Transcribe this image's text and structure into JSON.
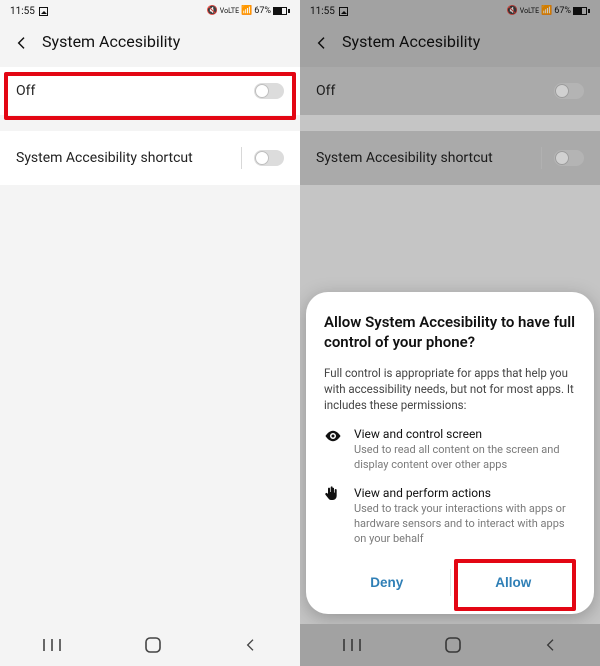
{
  "status": {
    "time": "11:55",
    "net_label": "VoLTE",
    "battery": "67%"
  },
  "header": {
    "title": "System Accesibility"
  },
  "rows": {
    "main_state": "Off",
    "shortcut_label": "System Accesibility shortcut"
  },
  "dialog": {
    "title": "Allow System Accesibility to have full control of your phone?",
    "description": "Full control is appropriate for apps that help you with accessibility needs, but not for most apps. It includes these permissions:",
    "perm1_title": "View and control screen",
    "perm1_sub": "Used to read all content on the screen and display content over other apps",
    "perm2_title": "View and perform actions",
    "perm2_sub": "Used to track your interactions with apps or hardware sensors and to interact with apps on your behalf",
    "deny": "Deny",
    "allow": "Allow"
  }
}
